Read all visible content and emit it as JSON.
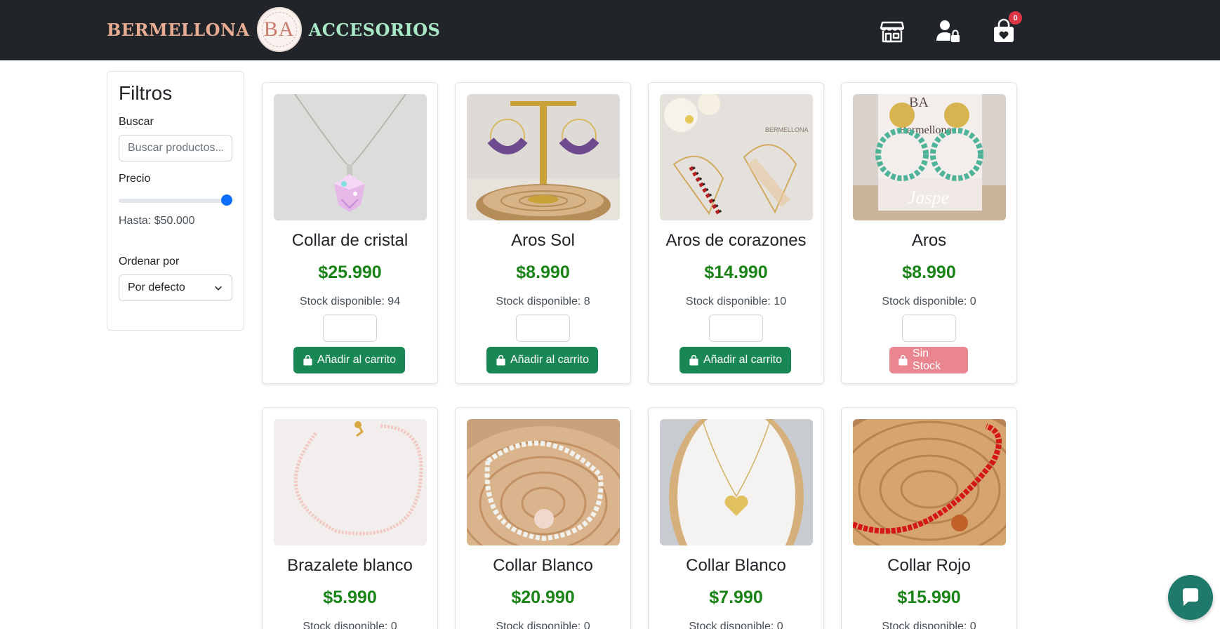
{
  "brand": {
    "left": "BERMELLONA",
    "logo": "BA",
    "right": "ACCESORIOS"
  },
  "nav": {
    "store_icon": "store-icon",
    "user_icon": "user-lock-icon",
    "cart_icon": "shopping-bag-heart-icon",
    "cart_count": "0"
  },
  "filters": {
    "title": "Filtros",
    "search_label": "Buscar",
    "search_placeholder": "Buscar productos...",
    "price_label": "Precio",
    "price_value": "Hasta: $50.000",
    "price_fraction": 1.0,
    "sort_label": "Ordenar por",
    "sort_value": "Por defecto"
  },
  "products": [
    {
      "name": "Collar de cristal",
      "price": "$25.990",
      "stock": "Stock disponible: 94",
      "button": "Añadir al carrito",
      "in_stock": true
    },
    {
      "name": "Aros Sol",
      "price": "$8.990",
      "stock": "Stock disponible: 8",
      "button": "Añadir al carrito",
      "in_stock": true
    },
    {
      "name": "Aros de corazones",
      "price": "$14.990",
      "stock": "Stock disponible: 10",
      "button": "Añadir al carrito",
      "in_stock": true
    },
    {
      "name": "Aros",
      "price": "$8.990",
      "stock": "Stock disponible: 0",
      "button": "Sin Stock",
      "in_stock": false
    },
    {
      "name": "Brazalete blanco",
      "price": "$5.990",
      "stock": "Stock disponible: 0",
      "button": "",
      "in_stock": false
    },
    {
      "name": "Collar Blanco",
      "price": "$20.990",
      "stock": "Stock disponible: 0",
      "button": "",
      "in_stock": false
    },
    {
      "name": "Collar Blanco",
      "price": "$7.990",
      "stock": "Stock disponible: 0",
      "button": "",
      "in_stock": false
    },
    {
      "name": "Collar Rojo",
      "price": "$15.990",
      "stock": "Stock disponible: 0",
      "button": "",
      "in_stock": false
    }
  ],
  "product_images": {
    "p3_watermark": "BERMELLONA",
    "p4_logo": "BA",
    "p4_brand": "Bermellona",
    "p4_caption": "Jaspe"
  },
  "chat": {
    "icon": "chat-bubble-icon"
  },
  "colors": {
    "navbar": "#212529",
    "brand_left": "#e8ac93",
    "brand_right": "#a9e8c6",
    "price": "#198316",
    "add_button": "#198754",
    "out_button": "#ea868f",
    "range_accent": "#0d6efd",
    "badge": "#dc3545",
    "chat": "#1f7a6c"
  }
}
